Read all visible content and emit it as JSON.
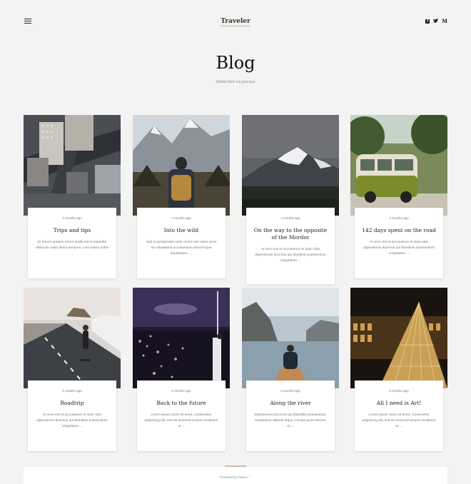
{
  "header": {
    "logo": "Traveler",
    "social": [
      "facebook-icon",
      "twitter-icon",
      "medium-icon"
    ],
    "social_glyphs": {
      "facebook": "f",
      "twitter": "🐦",
      "medium": "M"
    }
  },
  "page": {
    "title": "Blog",
    "subtitle": "Stories from my journeys"
  },
  "posts": [
    {
      "date": "3 months ago",
      "title": "Trips and tips",
      "excerpt": "Et harum quidem rerum facilis est et expedita distinctio. Nam libero tempore, cum soluta nobis ..."
    },
    {
      "date": "4 months ago",
      "title": "Into the wild",
      "excerpt": "Sed ut perspiciatis unde omnis iste natus error sit voluptatem accusantium doloremque laudantium, ..."
    },
    {
      "date": "4 months ago",
      "title": "On the way to the opposite of the Mordor",
      "excerpt": "At vero eos et accusamus et iusto odio dignissimos ducimus qui blanditiis praesentium voluptatum ..."
    },
    {
      "date": "4 months ago",
      "title": "142 days spent on the road",
      "excerpt": "At vero eos et accusamus et iusto odio dignissimos ducimus qui blanditiis praesentium voluptatum ..."
    },
    {
      "date": "5 months ago",
      "title": "Roadtrip",
      "excerpt": "At vero eos et accusamus et iusto odio dignissimos ducimus qui blanditiis praesentium voluptatum ..."
    },
    {
      "date": "5 months ago",
      "title": "Back to the future",
      "excerpt": "Lorem ipsum dolor sit amet, consectetur adipiscing elit, sed do eiusmod tempor incididunt ut ..."
    },
    {
      "date": "5 months ago",
      "title": "Along the river",
      "excerpt": "Dignissimos ducimus qui blanditiis praesentium voluptatum deleniti atque corrupti quos dolores et ..."
    },
    {
      "date": "6 months ago",
      "title": "All I need is Art!",
      "excerpt": "Lorem ipsum dolor sit amet, consectetur adipiscing elit, sed do eiusmod tempor incididunt ut ..."
    }
  ],
  "footer": {
    "text": "Powered by Fresco ♡"
  },
  "colors": {
    "background": "#f4f3f3",
    "accent": "#cdbfa3"
  }
}
